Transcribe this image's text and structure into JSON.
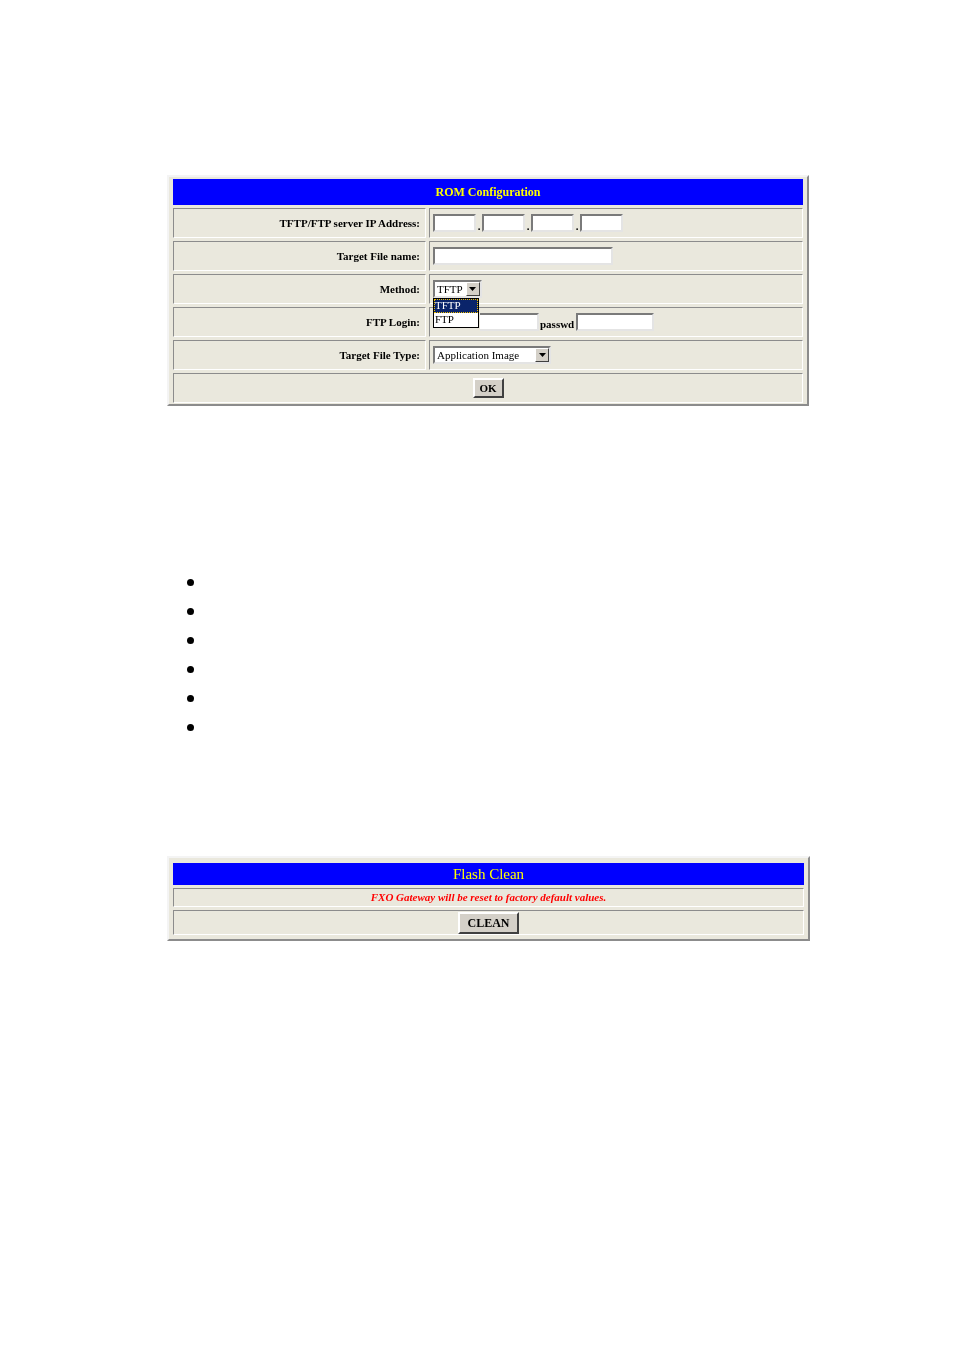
{
  "rom_configuration": {
    "title": "ROM Configuration",
    "rows": [
      {
        "kind": "ip",
        "label": "TFTP/FTP server IP Address:",
        "separators": [
          ".",
          ".",
          "."
        ]
      },
      {
        "kind": "text",
        "label": "Target File name:"
      },
      {
        "kind": "select",
        "label": "Method:",
        "value": "TFTP",
        "expanded": true,
        "options": [
          {
            "label": "TFTP",
            "selected": true
          },
          {
            "label": "FTP",
            "selected": false
          }
        ]
      },
      {
        "kind": "login",
        "label": "FTP Login:",
        "password_label": "passwd"
      },
      {
        "kind": "select",
        "label": "Target File Type:",
        "value": "Application Image",
        "expanded": false
      }
    ],
    "button": "OK"
  },
  "bullets": [
    {
      "kind": "dot"
    },
    {
      "kind": "dot"
    },
    {
      "kind": "dot"
    },
    {
      "kind": "dot"
    },
    {
      "kind": "dot"
    },
    {
      "kind": "dot"
    }
  ],
  "flash_clean": {
    "title": "Flash Clean",
    "message": "FXO Gateway will be reset to factory default values.",
    "button": "CLEAN"
  }
}
